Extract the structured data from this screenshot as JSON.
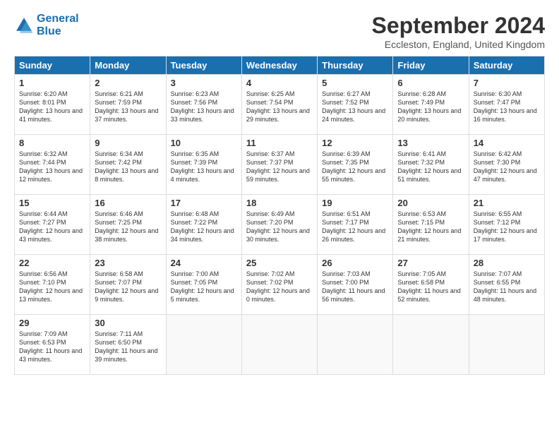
{
  "logo": {
    "line1": "General",
    "line2": "Blue"
  },
  "title": "September 2024",
  "location": "Eccleston, England, United Kingdom",
  "headers": [
    "Sunday",
    "Monday",
    "Tuesday",
    "Wednesday",
    "Thursday",
    "Friday",
    "Saturday"
  ],
  "weeks": [
    [
      {
        "day": "1",
        "sunrise": "Sunrise: 6:20 AM",
        "sunset": "Sunset: 8:01 PM",
        "daylight": "Daylight: 13 hours and 41 minutes."
      },
      {
        "day": "2",
        "sunrise": "Sunrise: 6:21 AM",
        "sunset": "Sunset: 7:59 PM",
        "daylight": "Daylight: 13 hours and 37 minutes."
      },
      {
        "day": "3",
        "sunrise": "Sunrise: 6:23 AM",
        "sunset": "Sunset: 7:56 PM",
        "daylight": "Daylight: 13 hours and 33 minutes."
      },
      {
        "day": "4",
        "sunrise": "Sunrise: 6:25 AM",
        "sunset": "Sunset: 7:54 PM",
        "daylight": "Daylight: 13 hours and 29 minutes."
      },
      {
        "day": "5",
        "sunrise": "Sunrise: 6:27 AM",
        "sunset": "Sunset: 7:52 PM",
        "daylight": "Daylight: 13 hours and 24 minutes."
      },
      {
        "day": "6",
        "sunrise": "Sunrise: 6:28 AM",
        "sunset": "Sunset: 7:49 PM",
        "daylight": "Daylight: 13 hours and 20 minutes."
      },
      {
        "day": "7",
        "sunrise": "Sunrise: 6:30 AM",
        "sunset": "Sunset: 7:47 PM",
        "daylight": "Daylight: 13 hours and 16 minutes."
      }
    ],
    [
      {
        "day": "8",
        "sunrise": "Sunrise: 6:32 AM",
        "sunset": "Sunset: 7:44 PM",
        "daylight": "Daylight: 13 hours and 12 minutes."
      },
      {
        "day": "9",
        "sunrise": "Sunrise: 6:34 AM",
        "sunset": "Sunset: 7:42 PM",
        "daylight": "Daylight: 13 hours and 8 minutes."
      },
      {
        "day": "10",
        "sunrise": "Sunrise: 6:35 AM",
        "sunset": "Sunset: 7:39 PM",
        "daylight": "Daylight: 13 hours and 4 minutes."
      },
      {
        "day": "11",
        "sunrise": "Sunrise: 6:37 AM",
        "sunset": "Sunset: 7:37 PM",
        "daylight": "Daylight: 12 hours and 59 minutes."
      },
      {
        "day": "12",
        "sunrise": "Sunrise: 6:39 AM",
        "sunset": "Sunset: 7:35 PM",
        "daylight": "Daylight: 12 hours and 55 minutes."
      },
      {
        "day": "13",
        "sunrise": "Sunrise: 6:41 AM",
        "sunset": "Sunset: 7:32 PM",
        "daylight": "Daylight: 12 hours and 51 minutes."
      },
      {
        "day": "14",
        "sunrise": "Sunrise: 6:42 AM",
        "sunset": "Sunset: 7:30 PM",
        "daylight": "Daylight: 12 hours and 47 minutes."
      }
    ],
    [
      {
        "day": "15",
        "sunrise": "Sunrise: 6:44 AM",
        "sunset": "Sunset: 7:27 PM",
        "daylight": "Daylight: 12 hours and 43 minutes."
      },
      {
        "day": "16",
        "sunrise": "Sunrise: 6:46 AM",
        "sunset": "Sunset: 7:25 PM",
        "daylight": "Daylight: 12 hours and 38 minutes."
      },
      {
        "day": "17",
        "sunrise": "Sunrise: 6:48 AM",
        "sunset": "Sunset: 7:22 PM",
        "daylight": "Daylight: 12 hours and 34 minutes."
      },
      {
        "day": "18",
        "sunrise": "Sunrise: 6:49 AM",
        "sunset": "Sunset: 7:20 PM",
        "daylight": "Daylight: 12 hours and 30 minutes."
      },
      {
        "day": "19",
        "sunrise": "Sunrise: 6:51 AM",
        "sunset": "Sunset: 7:17 PM",
        "daylight": "Daylight: 12 hours and 26 minutes."
      },
      {
        "day": "20",
        "sunrise": "Sunrise: 6:53 AM",
        "sunset": "Sunset: 7:15 PM",
        "daylight": "Daylight: 12 hours and 21 minutes."
      },
      {
        "day": "21",
        "sunrise": "Sunrise: 6:55 AM",
        "sunset": "Sunset: 7:12 PM",
        "daylight": "Daylight: 12 hours and 17 minutes."
      }
    ],
    [
      {
        "day": "22",
        "sunrise": "Sunrise: 6:56 AM",
        "sunset": "Sunset: 7:10 PM",
        "daylight": "Daylight: 12 hours and 13 minutes."
      },
      {
        "day": "23",
        "sunrise": "Sunrise: 6:58 AM",
        "sunset": "Sunset: 7:07 PM",
        "daylight": "Daylight: 12 hours and 9 minutes."
      },
      {
        "day": "24",
        "sunrise": "Sunrise: 7:00 AM",
        "sunset": "Sunset: 7:05 PM",
        "daylight": "Daylight: 12 hours and 5 minutes."
      },
      {
        "day": "25",
        "sunrise": "Sunrise: 7:02 AM",
        "sunset": "Sunset: 7:02 PM",
        "daylight": "Daylight: 12 hours and 0 minutes."
      },
      {
        "day": "26",
        "sunrise": "Sunrise: 7:03 AM",
        "sunset": "Sunset: 7:00 PM",
        "daylight": "Daylight: 11 hours and 56 minutes."
      },
      {
        "day": "27",
        "sunrise": "Sunrise: 7:05 AM",
        "sunset": "Sunset: 6:58 PM",
        "daylight": "Daylight: 11 hours and 52 minutes."
      },
      {
        "day": "28",
        "sunrise": "Sunrise: 7:07 AM",
        "sunset": "Sunset: 6:55 PM",
        "daylight": "Daylight: 11 hours and 48 minutes."
      }
    ],
    [
      {
        "day": "29",
        "sunrise": "Sunrise: 7:09 AM",
        "sunset": "Sunset: 6:53 PM",
        "daylight": "Daylight: 11 hours and 43 minutes."
      },
      {
        "day": "30",
        "sunrise": "Sunrise: 7:11 AM",
        "sunset": "Sunset: 6:50 PM",
        "daylight": "Daylight: 11 hours and 39 minutes."
      },
      null,
      null,
      null,
      null,
      null
    ]
  ]
}
